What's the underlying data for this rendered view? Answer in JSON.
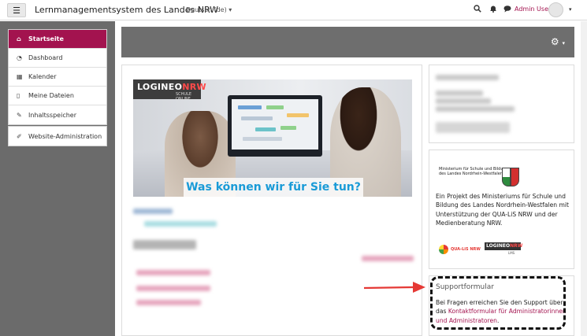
{
  "navbar": {
    "site_title": "Lernmanagementsystem des Landes NRW",
    "language": "Deutsch (de)",
    "user_name": "Admin User"
  },
  "sidebar": {
    "items": [
      {
        "label": "Startseite",
        "icon": "home-icon",
        "active": true
      },
      {
        "label": "Dashboard",
        "icon": "dashboard-icon"
      },
      {
        "label": "Kalender",
        "icon": "calendar-icon"
      },
      {
        "label": "Meine Dateien",
        "icon": "file-icon"
      },
      {
        "label": "Inhaltsspeicher",
        "icon": "brush-icon"
      }
    ],
    "admin_item": {
      "label": "Website-Administration",
      "icon": "wrench-icon"
    }
  },
  "hero": {
    "logo_logineo": "LOGINEO",
    "logo_nrw": "NRW",
    "logo_sub": "SCHULE ONLINE",
    "slogan": "Was können wir für Sie tun?"
  },
  "ministry_block": {
    "ministry_name": "Ministerium für Schule und Bildung des Landes Nordrhein-Westfalen",
    "project_text": "Ein Projekt des Ministeriums für Schule und Bildung des Landes Nordrhein-Westfalen mit Unterstützung der QUA-LiS NRW und der Medienberatung NRW.",
    "qua_lis_logo": "QUA-LiS NRW",
    "logineo_small_1": "LOGINEO",
    "logineo_small_2": "NRW",
    "logineo_small_sub": "LMS"
  },
  "support_block": {
    "title": "Supportformular",
    "text_before": "Bei Fragen erreichen Sie den Support über das ",
    "link_text": "Kontaktformular für Administratorinnen und Administratoren",
    "text_after": "."
  },
  "colors": {
    "accent": "#a3134f",
    "drawer": "#6b6b6b",
    "header": "#6e6e6e",
    "slogan": "#1a9bd7",
    "arrow": "#e53935"
  }
}
